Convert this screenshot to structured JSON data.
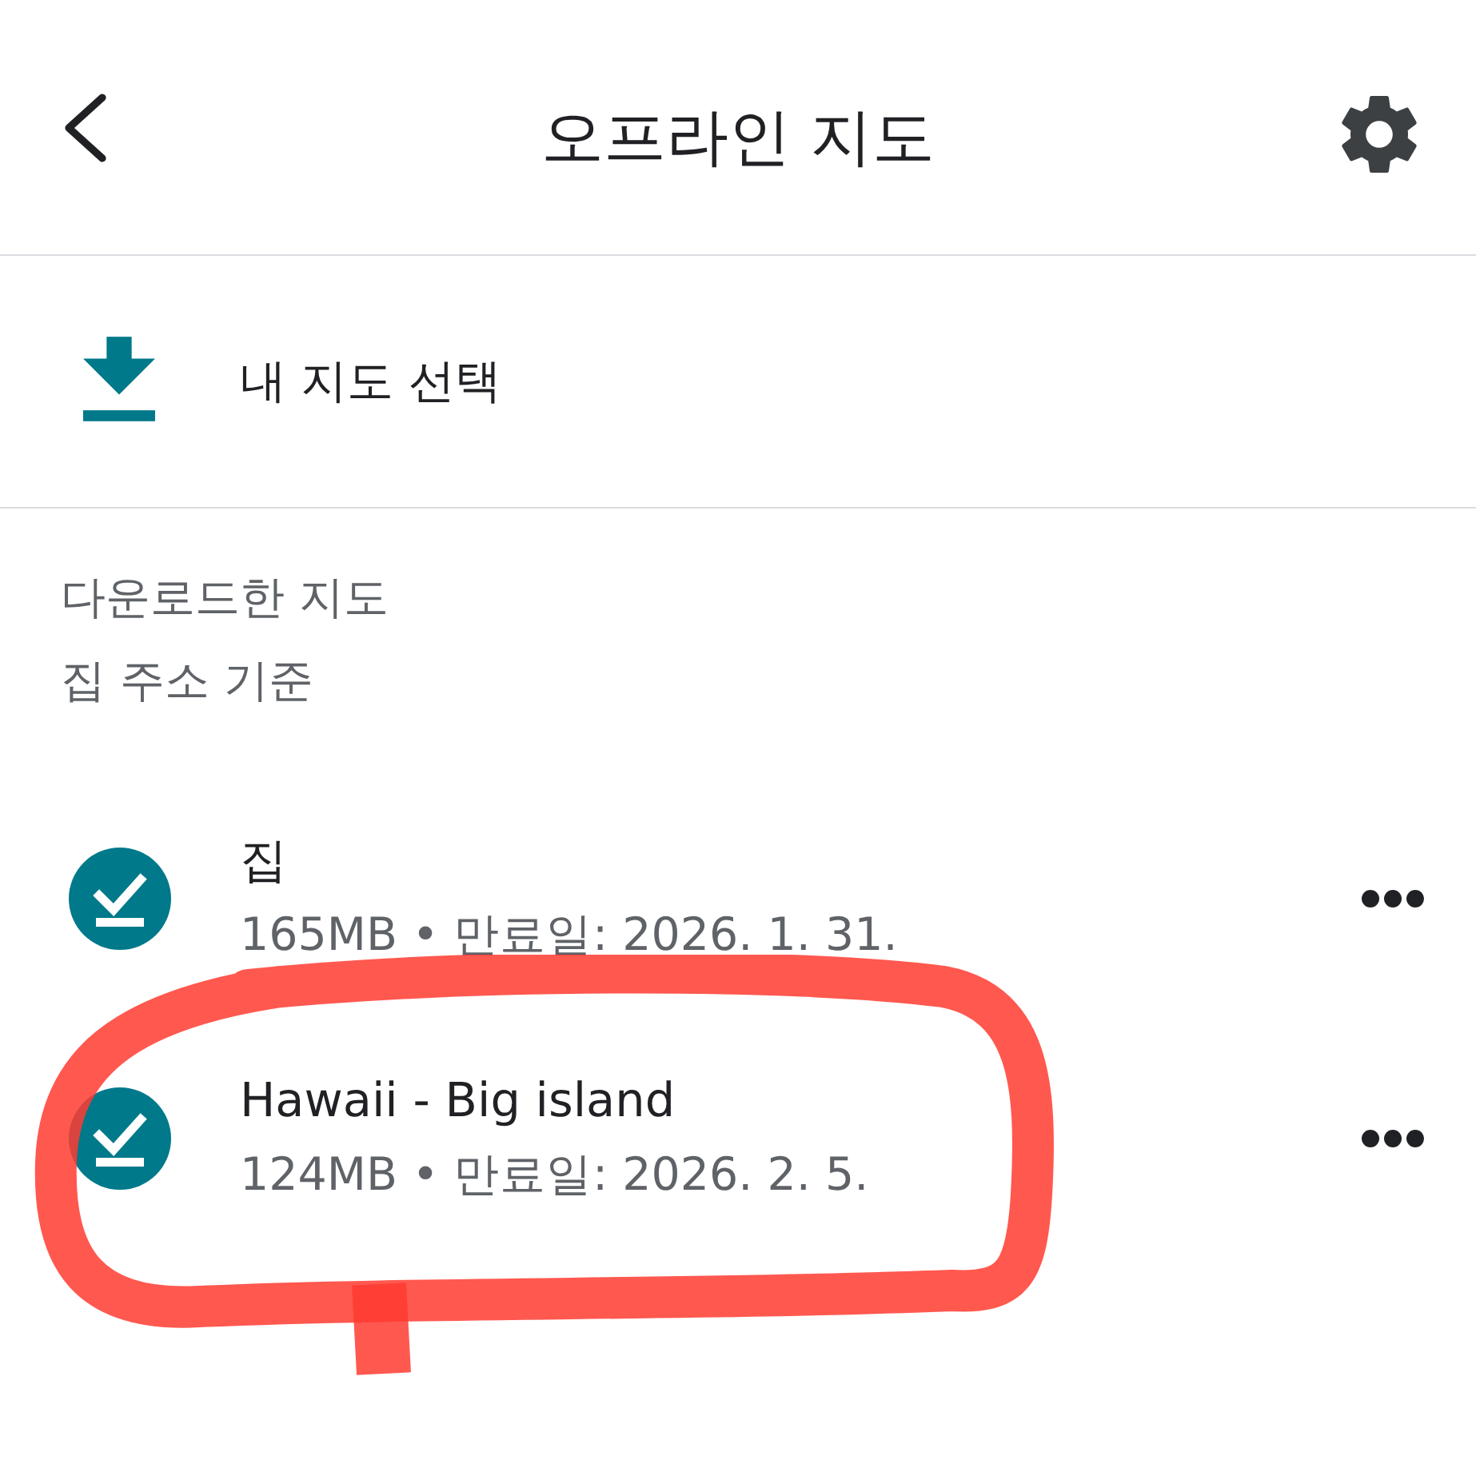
{
  "header": {
    "title": "오프라인 지도"
  },
  "select_map": {
    "label": "내 지도 선택"
  },
  "section": {
    "title": "다운로드한 지도",
    "subtitle": "집 주소 기준"
  },
  "maps": [
    {
      "name": "집",
      "meta": "165MB • 만료일: 2026. 1. 31.",
      "circled": false
    },
    {
      "name": "Hawaii - Big island",
      "meta": "124MB • 만료일: 2026. 2. 5.",
      "circled": true
    }
  ]
}
